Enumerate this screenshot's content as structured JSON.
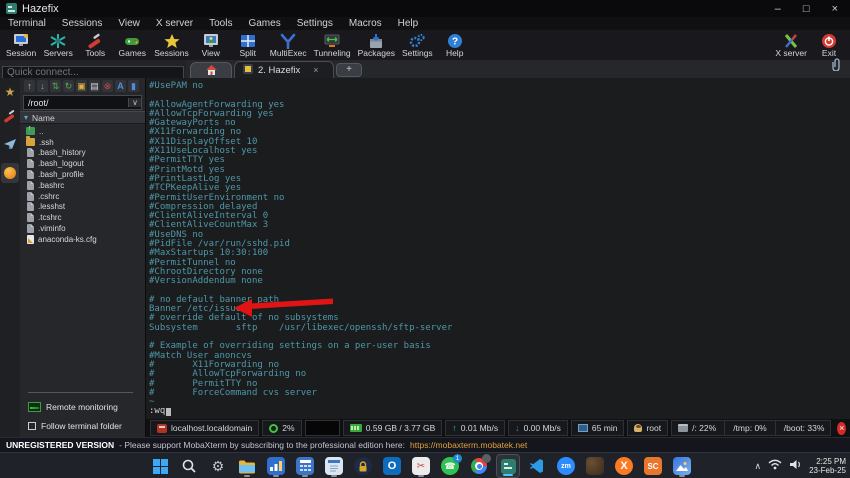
{
  "window": {
    "title": "Hazefix",
    "controls": {
      "minimize": "–",
      "maximize": "□",
      "close": "×"
    }
  },
  "menu": {
    "items": [
      "Terminal",
      "Sessions",
      "View",
      "X server",
      "Tools",
      "Games",
      "Settings",
      "Macros",
      "Help"
    ]
  },
  "toolbar": {
    "items": [
      {
        "label": "Session",
        "icon": "session-monitor-icon"
      },
      {
        "label": "Servers",
        "icon": "servers-icon"
      },
      {
        "label": "Tools",
        "icon": "tools-knife-icon"
      },
      {
        "label": "Games",
        "icon": "games-gamepad-icon"
      },
      {
        "label": "Sessions",
        "icon": "sessions-star-icon"
      },
      {
        "label": "View",
        "icon": "view-monitor-icon"
      },
      {
        "label": "Split",
        "icon": "split-grid-icon"
      },
      {
        "label": "MultiExec",
        "icon": "multiexec-y-icon"
      },
      {
        "label": "Tunneling",
        "icon": "tunneling-arrows-icon"
      },
      {
        "label": "Packages",
        "icon": "packages-box-icon"
      },
      {
        "label": "Settings",
        "icon": "settings-gears-icon"
      },
      {
        "label": "Help",
        "icon": "help-question-icon"
      }
    ],
    "right": [
      {
        "label": "X server",
        "icon": "xserver-x-icon"
      },
      {
        "label": "Exit",
        "icon": "exit-power-icon"
      }
    ]
  },
  "quick_connect": {
    "placeholder": "Quick connect..."
  },
  "tabs": {
    "active": {
      "label": "2. Hazefix",
      "close_glyph": "×"
    },
    "new_tab_glyph": "+"
  },
  "sidebar": {
    "file_toolbar": [
      {
        "name": "upload",
        "glyph": "↑"
      },
      {
        "name": "download",
        "glyph": "↓"
      },
      {
        "name": "sync",
        "glyph": "⇅"
      },
      {
        "name": "refresh",
        "glyph": "↻"
      },
      {
        "name": "new-folder",
        "glyph": "▣"
      },
      {
        "name": "new-file",
        "glyph": "▤"
      },
      {
        "name": "delete",
        "glyph": "⊗"
      },
      {
        "name": "rename",
        "glyph": "A"
      },
      {
        "name": "open-terminal",
        "glyph": "▮"
      }
    ],
    "path": "/root/",
    "path_dropdown_glyph": "∨",
    "header": {
      "label": "Name",
      "sort_glyph": "▾"
    },
    "files": [
      {
        "name": "..",
        "type": "up"
      },
      {
        "name": ".ssh",
        "type": "folder"
      },
      {
        "name": ".bash_history",
        "type": "file"
      },
      {
        "name": ".bash_logout",
        "type": "file"
      },
      {
        "name": ".bash_profile",
        "type": "file"
      },
      {
        "name": ".bashrc",
        "type": "file"
      },
      {
        "name": ".cshrc",
        "type": "file"
      },
      {
        "name": ".lesshst",
        "type": "file"
      },
      {
        "name": ".tcshrc",
        "type": "file"
      },
      {
        "name": ".viminfo",
        "type": "file"
      },
      {
        "name": "anaconda-ks.cfg",
        "type": "cfg"
      }
    ],
    "remote_monitoring_label": "Remote monitoring",
    "follow_terminal_folder_label": "Follow terminal folder"
  },
  "terminal": {
    "lines": [
      "#UsePAM no",
      "",
      "#AllowAgentForwarding yes",
      "#AllowTcpForwarding yes",
      "#GatewayPorts no",
      "#X11Forwarding no",
      "#X11DisplayOffset 10",
      "#X11UseLocalhost yes",
      "#PermitTTY yes",
      "#PrintMotd yes",
      "#PrintLastLog yes",
      "#TCPKeepAlive yes",
      "#PermitUserEnvironment no",
      "#Compression delayed",
      "#ClientAliveInterval 0",
      "#ClientAliveCountMax 3",
      "#UseDNS no",
      "#PidFile /var/run/sshd.pid",
      "#MaxStartups 10:30:100",
      "#PermitTunnel no",
      "#ChrootDirectory none",
      "#VersionAddendum none",
      "",
      "# no default banner path",
      "Banner /etc/issue",
      "# override default of no subsystems",
      "Subsystem\tsftp\t/usr/libexec/openssh/sftp-server",
      "",
      "# Example of overriding settings on a per-user basis",
      "#Match User anoncvs",
      "#\tX11Forwarding no",
      "#\tAllowTcpForwarding no",
      "#\tPermitTTY no",
      "#\tForceCommand cvs server",
      "~"
    ],
    "command": ":wq"
  },
  "status_bar": {
    "host": "localhost.localdomain",
    "cpu_percent": "2%",
    "memory": "0.59 GB / 3.77 GB",
    "upload_glyph": "↑",
    "upload_rate": "0.01 Mb/s",
    "download_glyph": "↓",
    "download_rate": "0.00 Mb/s",
    "uptime": "65 min",
    "user": "root",
    "disk_root": "/: 22%",
    "disk_tmp": "/tmp: 0%",
    "disk_boot": "/boot: 33%",
    "close_glyph": "×"
  },
  "footer": {
    "badge": "UNREGISTERED VERSION",
    "message": "- Please support MobaXterm by subscribing to the professional edition here:",
    "link": "https://mobaxterm.mobatek.net"
  },
  "taskbar": {
    "outlook_label": "O",
    "zoom_label": "zm",
    "xampp_label": "X",
    "sc_label": "SC",
    "whatsapp_badge": "1",
    "tray": {
      "chevron": "∧",
      "time": "2:25 PM",
      "date": "23-Feb-25"
    }
  }
}
